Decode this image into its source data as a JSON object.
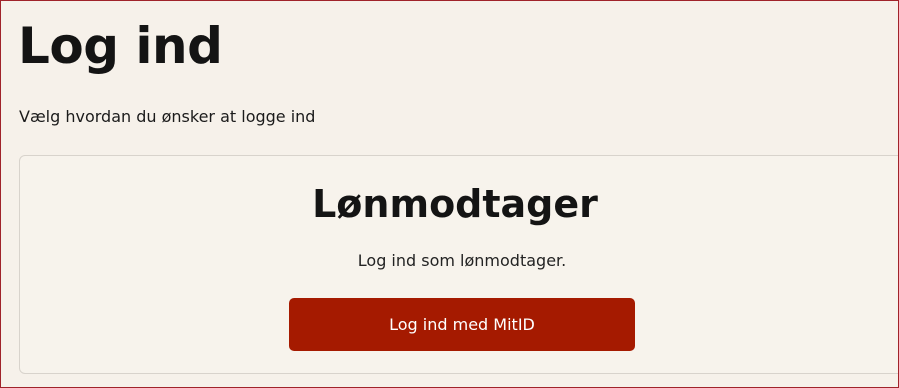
{
  "page": {
    "title": "Log ind",
    "subtitle": "Vælg hvordan du ønsker at logge ind"
  },
  "card": {
    "title": "Lønmodtager",
    "description": "Log ind som lønmodtager.",
    "button_label": "Log ind med MitID"
  },
  "colors": {
    "background": "#f6f1ea",
    "frame_border": "#a0232a",
    "button_bg": "#a51a00",
    "text": "#141414"
  }
}
